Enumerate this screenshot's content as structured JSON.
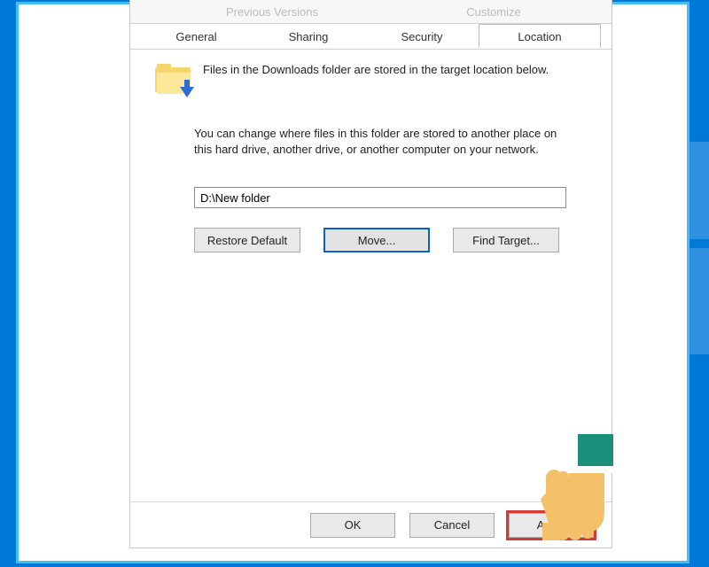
{
  "tabs_top": {
    "prev": "Previous Versions",
    "customize": "Customize"
  },
  "tabs": {
    "general": "General",
    "sharing": "Sharing",
    "security": "Security",
    "location": "Location"
  },
  "intro": "Files in the Downloads folder are stored in the target location below.",
  "detail": "You can change where files in this folder are stored to another place on this hard drive, another drive, or another computer on your network.",
  "path_value": "D:\\New folder",
  "buttons": {
    "restore": "Restore Default",
    "move": "Move...",
    "find": "Find Target..."
  },
  "bottom": {
    "ok": "OK",
    "cancel": "Cancel",
    "apply": "Apply"
  }
}
